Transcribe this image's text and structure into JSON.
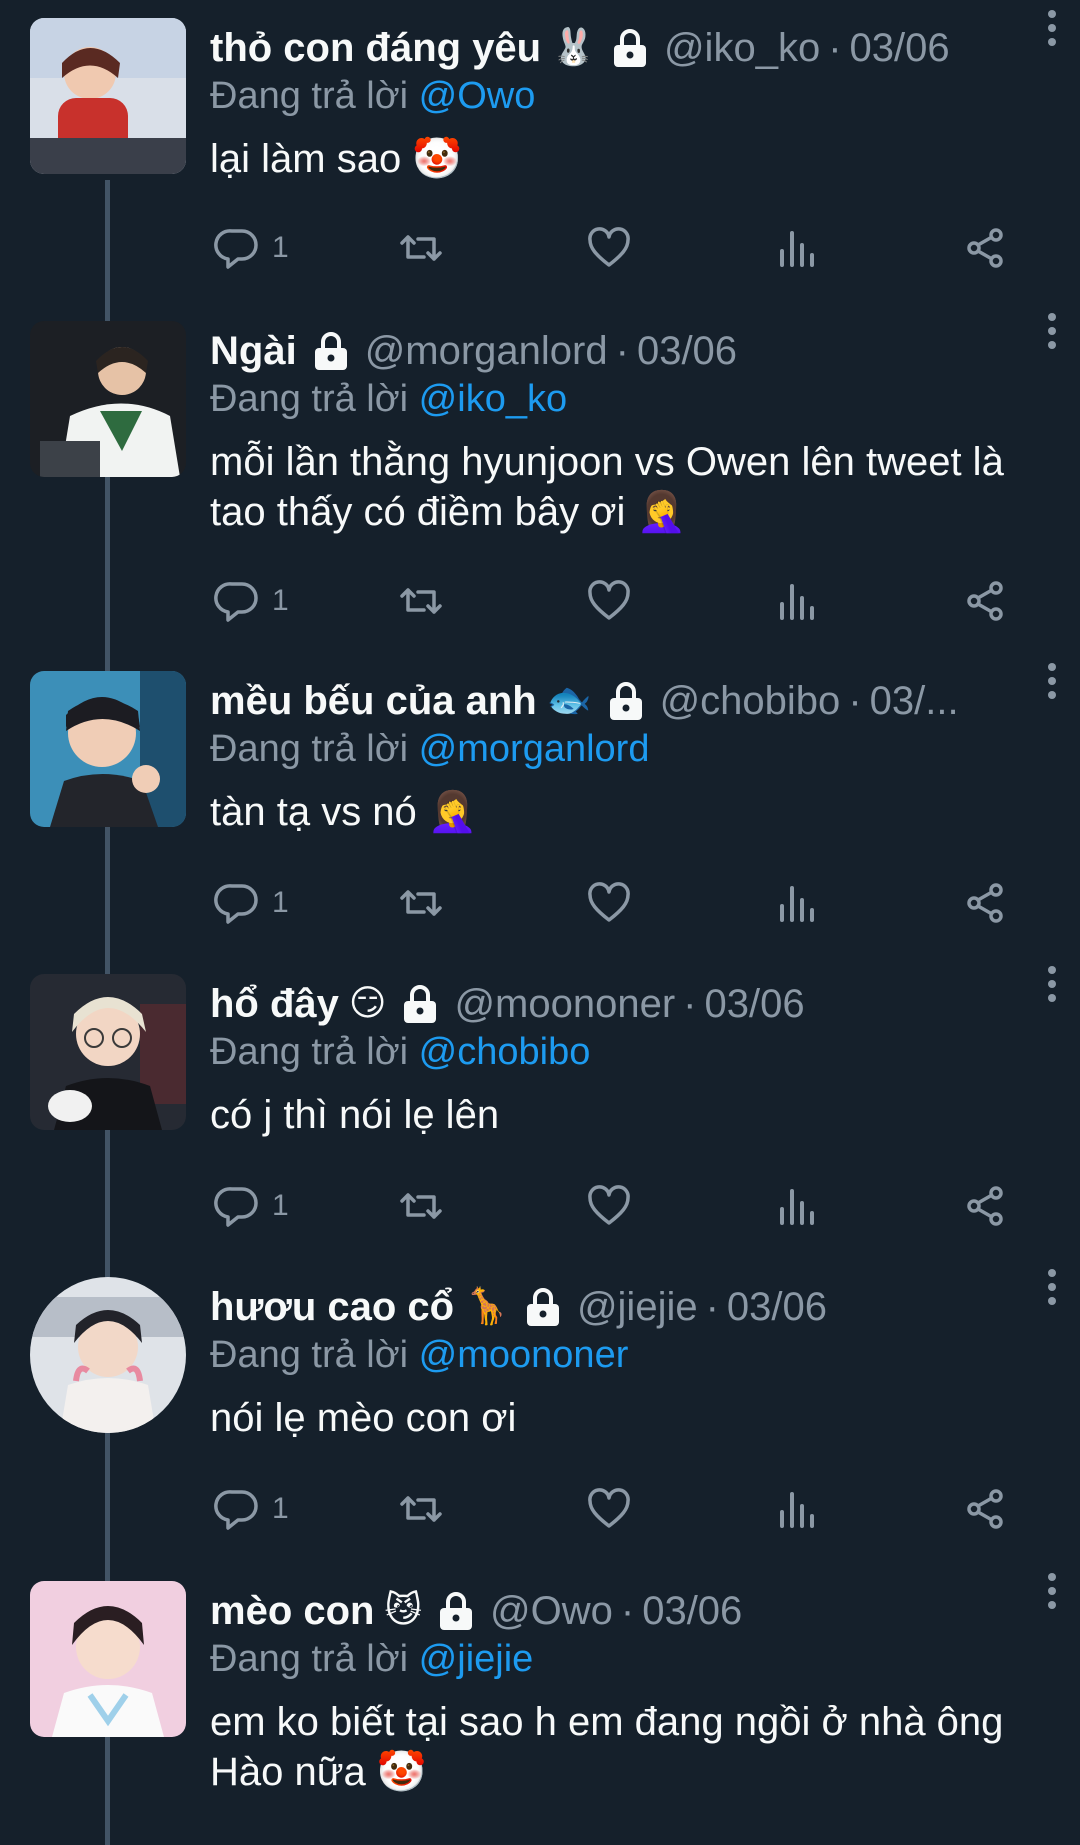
{
  "ui": {
    "replying_prefix": "Đang trả lời",
    "separator": "·"
  },
  "colors": {
    "background": "#15202b",
    "text": "#f7f9f9",
    "muted": "#8b98a5",
    "mention": "#1d9bf0",
    "thread_line": "#425466"
  },
  "tweets": [
    {
      "name": "thỏ con đáng yêu",
      "emoji": "🐰",
      "handle": "@iko_ko",
      "date": "03/06",
      "reply_to": "@Owo",
      "text": "lại làm sao 🤡",
      "reply_count": "1",
      "protected": true
    },
    {
      "name": "Ngài",
      "emoji": "",
      "handle": "@morganlord",
      "date": "03/06",
      "reply_to": "@iko_ko",
      "text": "mỗi lần thằng hyunjoon vs Owen lên tweet là\ntao thấy có điềm bây ơi 🤦‍♀️",
      "reply_count": "1",
      "protected": true
    },
    {
      "name": "mều bếu của anh",
      "emoji": "🐟",
      "handle": "@chobibo",
      "date": "03/...",
      "reply_to": "@morganlord",
      "text": "tàn tạ vs nó 🤦‍♀️",
      "reply_count": "1",
      "protected": true
    },
    {
      "name": "hổ đây",
      "emoji": "😏",
      "handle": "@moononer",
      "date": "03/06",
      "reply_to": "@chobibo",
      "text": "có j thì nói lẹ lên",
      "reply_count": "1",
      "protected": true
    },
    {
      "name": "hươu cao cổ",
      "emoji": "🦒",
      "handle": "@jiejie",
      "date": "03/06",
      "reply_to": "@moononer",
      "text": "nói lẹ mèo con ơi",
      "reply_count": "1",
      "protected": true
    },
    {
      "name": "mèo con",
      "emoji": "😼",
      "handle": "@Owo",
      "date": "03/06",
      "reply_to": "@jiejie",
      "text": "em ko biết tại sao h em đang ngồi ở nhà ông\nHào nữa 🤡",
      "reply_count": "",
      "protected": true
    }
  ]
}
